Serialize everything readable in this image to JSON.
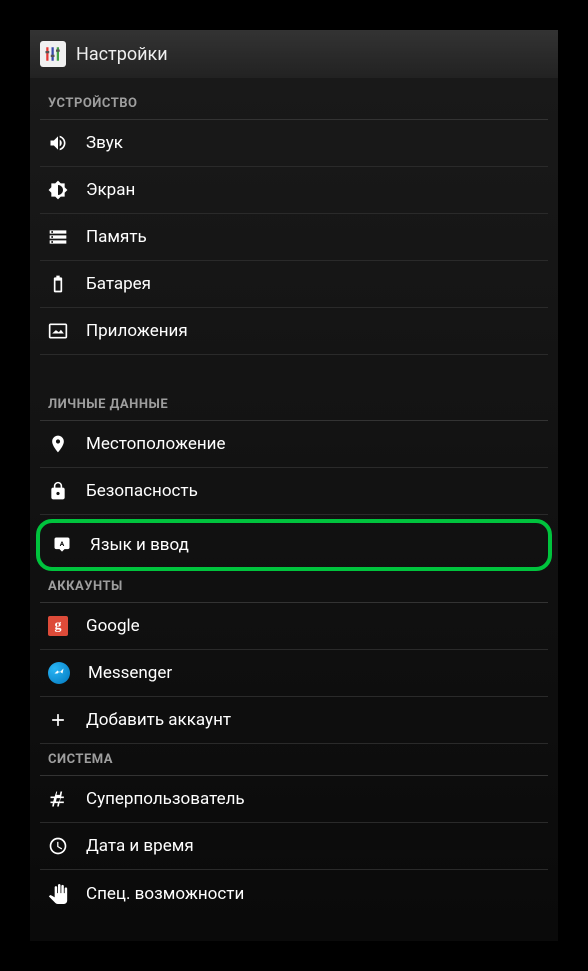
{
  "header": {
    "title": "Настройки"
  },
  "sections": {
    "device": {
      "title": "УСТРОЙСТВО",
      "sound": "Звук",
      "display": "Экран",
      "storage": "Память",
      "battery": "Батарея",
      "apps": "Приложения"
    },
    "personal": {
      "title": "ЛИЧНЫЕ ДАННЫЕ",
      "location": "Местоположение",
      "security": "Безопасность",
      "language": "Язык и ввод"
    },
    "accounts": {
      "title": "АККАУНТЫ",
      "google": "Google",
      "messenger": "Messenger",
      "add": "Добавить аккаунт"
    },
    "system": {
      "title": "СИСТЕМА",
      "superuser": "Суперпользователь",
      "datetime": "Дата и время",
      "accessibility": "Спец. возможности"
    }
  }
}
